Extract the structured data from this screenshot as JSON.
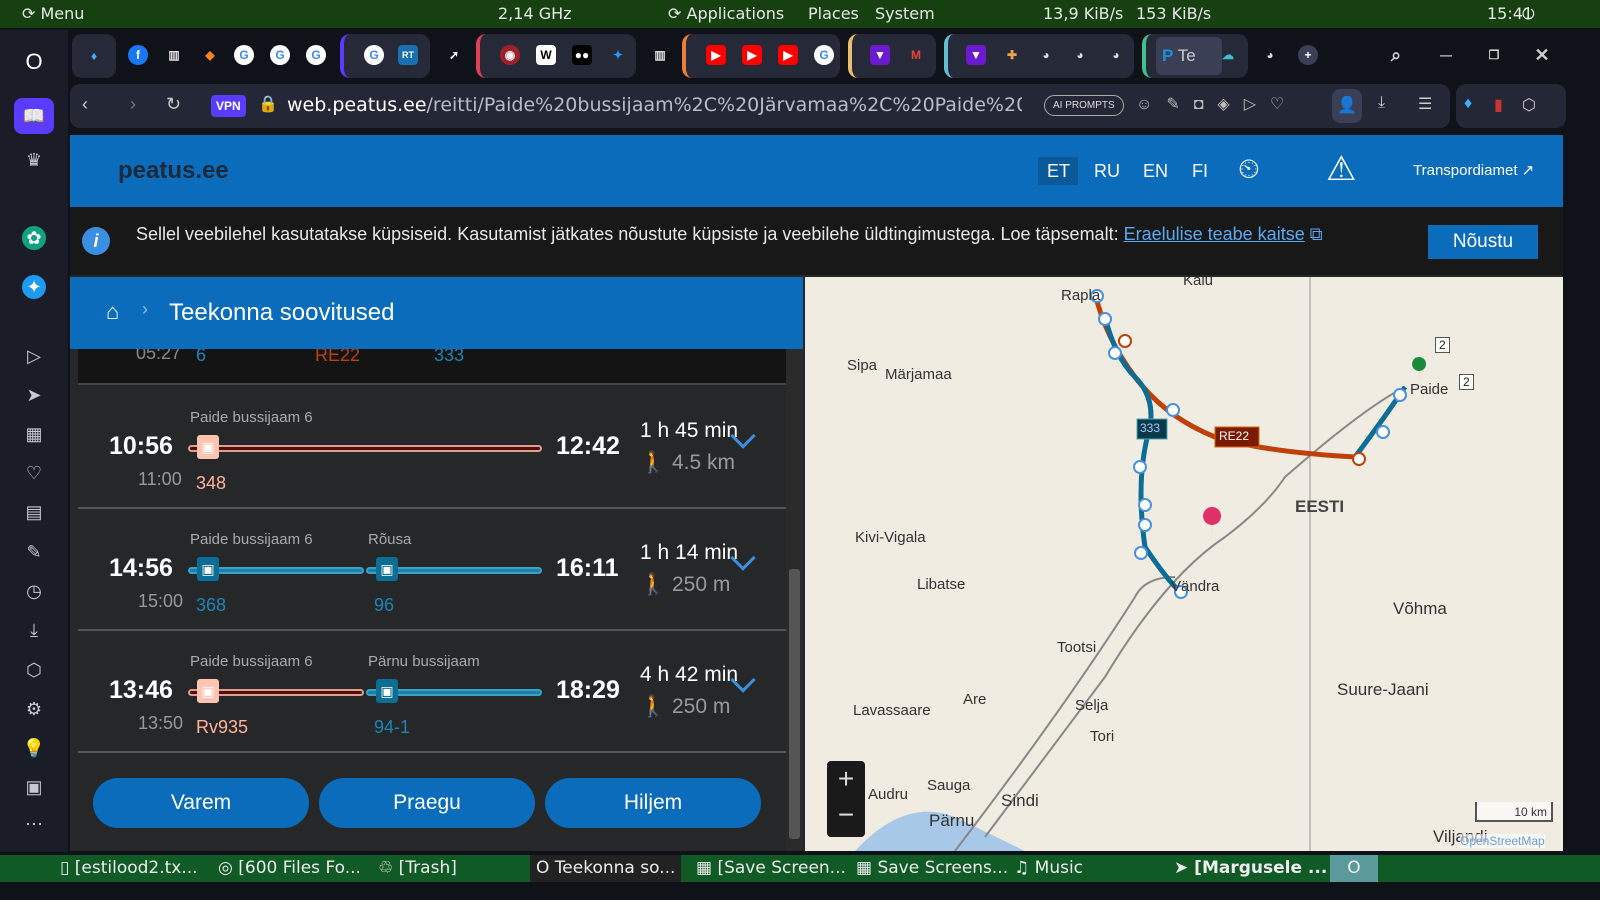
{
  "system_panel": {
    "menu": "Menu",
    "cpu": "2,14 GHz",
    "applications": "Applications",
    "places": "Places",
    "system": "System",
    "net_down": "13,9 KiB/s",
    "net_up": "153 KiB/s",
    "clock": "15:41"
  },
  "browser": {
    "vpn": "VPN",
    "url_host": "web.peatus.ee",
    "url_path": "/reitti/Paide%20bussijaam%2C%20Järvamaa%2C%20Paide%20linn",
    "ai_prompts": "AI PROMPTS",
    "active_tab": "Te"
  },
  "site": {
    "logo": "peatus.ee",
    "languages": [
      "ET",
      "RU",
      "EN",
      "FI"
    ],
    "active_language": "ET",
    "transport_link": "Transpordiamet",
    "cookie": {
      "text": "Sellel veebilehel kasutatakse küpsiseid. Kasutamist jätkates nõustute küpsiste ja veebilehe üldtingimustega. Loe täpsemalt:",
      "link": "Eraelulise teabe kaitse",
      "accept": "Nõustu"
    },
    "breadcrumb_title": "Teekonna soovitused",
    "partial_row": {
      "time": "05:27",
      "lines": [
        {
          "label": "6",
          "mode": "bus"
        },
        {
          "label": "RE22",
          "mode": "rail"
        },
        {
          "label": "333",
          "mode": "bus"
        }
      ]
    },
    "itineraries": [
      {
        "dep": "10:56",
        "sched": "11:00",
        "arr": "12:42",
        "duration": "1 h 45 min",
        "walk": "4.5 km",
        "legs": [
          {
            "stop": "Paide bussijaam 6",
            "line": "348",
            "mode": "train"
          }
        ]
      },
      {
        "dep": "14:56",
        "sched": "15:00",
        "arr": "16:11",
        "duration": "1 h 14 min",
        "walk": "250 m",
        "legs": [
          {
            "stop": "Paide bussijaam 6",
            "line": "368",
            "mode": "bus"
          },
          {
            "stop": "Rõusa",
            "line": "96",
            "mode": "bus"
          }
        ]
      },
      {
        "dep": "13:46",
        "sched": "13:50",
        "arr": "18:29",
        "duration": "4 h 42 min",
        "walk": "250 m",
        "legs": [
          {
            "stop": "Paide bussijaam 6",
            "line": "Rv935",
            "mode": "train"
          },
          {
            "stop": "Pärnu bussijaam",
            "line": "94-1",
            "mode": "bus"
          }
        ]
      }
    ],
    "buttons": {
      "earlier": "Varem",
      "now": "Praegu",
      "later": "Hiljem"
    },
    "map": {
      "places": [
        "Kaiu",
        "Rapla",
        "Sipa",
        "Märjamaa",
        "Paide",
        "Kivi-Vigala",
        "Libatse",
        "EESTI",
        "Vändra",
        "Tootsi",
        "Võhma",
        "Are",
        "Lavassaare",
        "Suure-Jaani",
        "Sauga",
        "Audru",
        "Sindi",
        "Tori",
        "Selja",
        "Pärnu",
        "Viljandi"
      ],
      "route_labels": [
        "333",
        "RE22"
      ],
      "road_numbers": [
        "2",
        "2"
      ],
      "scale": "10 km",
      "attribution": "OpenStreetMap",
      "zoom_in": "+",
      "zoom_out": "−"
    },
    "colors": {
      "brand": "#0a6cbb",
      "rail": "#c0400a",
      "bus": "#0c6d95"
    }
  },
  "taskbar": {
    "items": [
      "[estilood2.tx...",
      "[600 Files Fo...",
      "[Trash]",
      "Teekonna so...",
      "[Save Screen...",
      "Save Screens...",
      "Music",
      "[Margusele ..."
    ]
  }
}
